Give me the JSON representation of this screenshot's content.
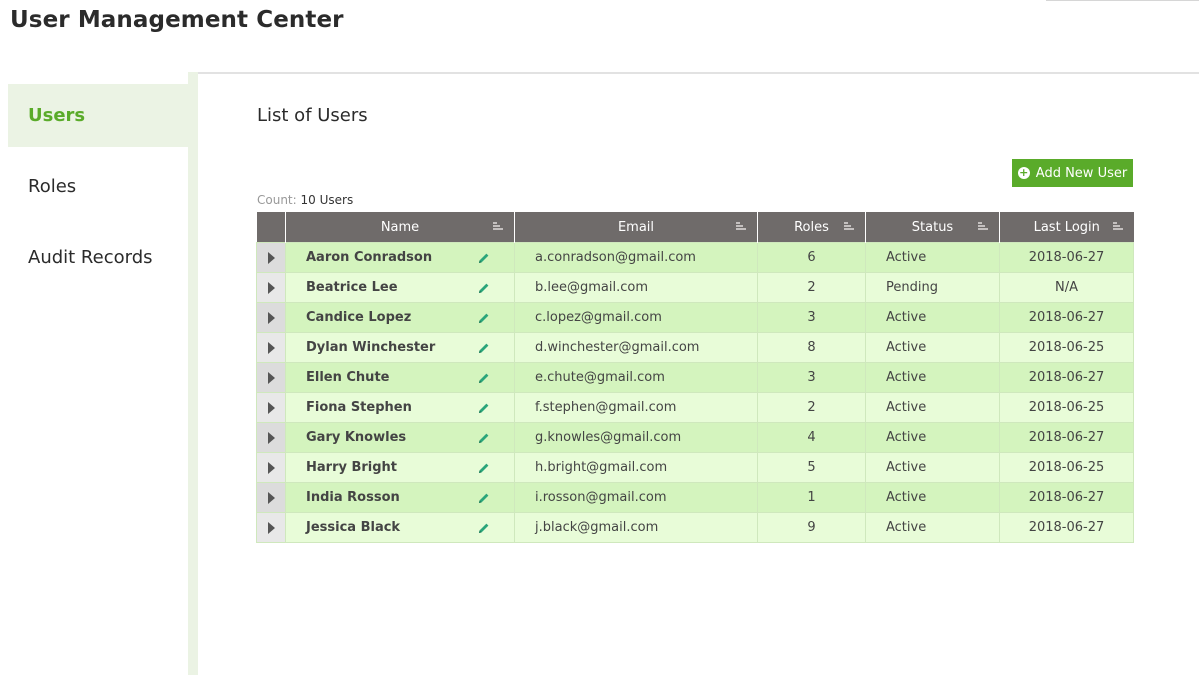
{
  "app": {
    "title": "User Management Center"
  },
  "sidebar": {
    "items": [
      {
        "label": "Users",
        "active": true
      },
      {
        "label": "Roles",
        "active": false
      },
      {
        "label": "Audit Records",
        "active": false
      }
    ]
  },
  "main": {
    "title": "List of Users",
    "add_button_label": "Add New User",
    "count_label": "Count:",
    "count_value": "10 Users",
    "columns": [
      "Name",
      "Email",
      "Roles",
      "Status",
      "Last Login"
    ],
    "rows": [
      {
        "name": "Aaron Conradson",
        "email": "a.conradson@gmail.com",
        "roles": "6",
        "status": "Active",
        "last_login": "2018-06-27"
      },
      {
        "name": "Beatrice Lee",
        "email": "b.lee@gmail.com",
        "roles": "2",
        "status": "Pending",
        "last_login": "N/A"
      },
      {
        "name": "Candice Lopez",
        "email": "c.lopez@gmail.com",
        "roles": "3",
        "status": "Active",
        "last_login": "2018-06-27"
      },
      {
        "name": "Dylan Winchester",
        "email": "d.winchester@gmail.com",
        "roles": "8",
        "status": "Active",
        "last_login": "2018-06-25"
      },
      {
        "name": "Ellen Chute",
        "email": "e.chute@gmail.com",
        "roles": "3",
        "status": "Active",
        "last_login": "2018-06-27"
      },
      {
        "name": "Fiona Stephen",
        "email": "f.stephen@gmail.com",
        "roles": "2",
        "status": "Active",
        "last_login": "2018-06-25"
      },
      {
        "name": "Gary Knowles",
        "email": "g.knowles@gmail.com",
        "roles": "4",
        "status": "Active",
        "last_login": "2018-06-27"
      },
      {
        "name": "Harry Bright",
        "email": "h.bright@gmail.com",
        "roles": "5",
        "status": "Active",
        "last_login": "2018-06-25"
      },
      {
        "name": "India Rosson",
        "email": "i.rosson@gmail.com",
        "roles": "1",
        "status": "Active",
        "last_login": "2018-06-27"
      },
      {
        "name": "Jessica Black",
        "email": "j.black@gmail.com",
        "roles": "9",
        "status": "Active",
        "last_login": "2018-06-27"
      }
    ]
  },
  "colors": {
    "accent": "#5aab2a",
    "header_bg": "#6f6b6a",
    "row_odd": "#d4f4be",
    "row_even": "#e8fcd8",
    "sidebar_active_bg": "#ebf3e4"
  },
  "icons": {
    "add": "plus-circle-icon",
    "edit": "pencil-icon",
    "expand": "caret-right-icon",
    "sort": "sort-icon"
  }
}
